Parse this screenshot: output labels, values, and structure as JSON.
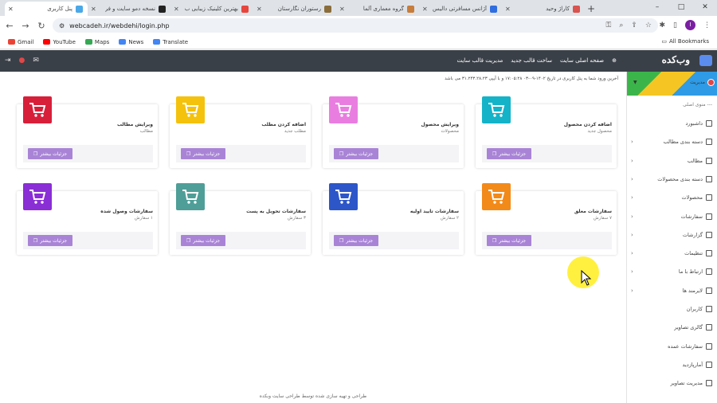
{
  "browser": {
    "tabs": [
      {
        "title": "پنل کاربری",
        "color": "#4aa8e8",
        "active": true
      },
      {
        "title": "نسخه دمو سایت و فر",
        "color": "#222222"
      },
      {
        "title": "بهترین کلینیک زیبایی ب",
        "color": "#e8453c"
      },
      {
        "title": "رستوران نگارستان",
        "color": "#8a6d3b"
      },
      {
        "title": "گروه معماری آلما",
        "color": "#c77d3b"
      },
      {
        "title": "آژانس مسافرتی دالیس",
        "color": "#2f6de1"
      },
      {
        "title": "کاراژ وحید",
        "color": "#d9534f"
      }
    ],
    "new_tab": "+",
    "window_controls": [
      "–",
      "□",
      "✕"
    ],
    "url": "webcadeh.ir/webdehi/login.php",
    "bookmarks": [
      {
        "label": "Gmail",
        "color": "#ea4335"
      },
      {
        "label": "YouTube",
        "color": "#ff0000"
      },
      {
        "label": "Maps",
        "color": "#34a853"
      },
      {
        "label": "News",
        "color": "#4285f4"
      },
      {
        "label": "Translate",
        "color": "#4285f4"
      }
    ],
    "all_bookmarks": "All Bookmarks",
    "profile_initial": "I"
  },
  "topnav": {
    "links": [
      "صفحه اصلی سایت",
      "ساخت قالب جدید",
      "مدیریت قالب سایت"
    ]
  },
  "brand": {
    "logo_text": "وب‌کده"
  },
  "user": {
    "name": "مدیریت"
  },
  "sidebar": {
    "menu_title": "--- منوی اصلی",
    "items": [
      {
        "label": "داشبورد",
        "caret": false
      },
      {
        "label": "دسته بندی مطالب",
        "caret": true
      },
      {
        "label": "مطالب",
        "caret": true
      },
      {
        "label": "دسته بندی محصولات",
        "caret": true
      },
      {
        "label": "محصولات",
        "caret": true
      },
      {
        "label": "سفارشات",
        "caret": true
      },
      {
        "label": "گزارشات",
        "caret": true
      },
      {
        "label": "تنظیمات",
        "caret": true
      },
      {
        "label": "ارتباط با ما",
        "caret": true
      },
      {
        "label": "لایرمند ها",
        "caret": true
      },
      {
        "label": "کاربران",
        "caret": false
      },
      {
        "label": "گالری تصاویر",
        "caret": false
      },
      {
        "label": "سفارشات عمده",
        "caret": false
      },
      {
        "label": "آمارپازدید",
        "caret": false
      },
      {
        "label": "مدیریت تصاویر",
        "caret": false
      }
    ]
  },
  "last_login": "آخرین ورود شما به پنل کاربری در تاریخ ۱۴۰۲-۰۹-۰۳ ۱۷:۰۵:۲۸ و با آیپی ۳۱.۲۴۳.۲۸.۲۳ می باشد",
  "cards": [
    {
      "title": "اضافه کردن محصول",
      "sub": "محصول جدید",
      "color": "#14b3c8",
      "icon": "cart-add-icon",
      "btn": "جزئیات بیشتر"
    },
    {
      "title": "ویرایش محصول",
      "sub": "محصولات",
      "color": "#e97ee0",
      "icon": "cart-edit-icon",
      "btn": "جزئیات بیشتر"
    },
    {
      "title": "اضافه کردن مطلب",
      "sub": "مطلب جدید",
      "color": "#f4c20d",
      "icon": "file-add-icon",
      "btn": "جزئیات بیشتر"
    },
    {
      "title": "ویرایش مطالب",
      "sub": "مطالب",
      "color": "#d81f3a",
      "icon": "file-remove-icon",
      "btn": "جزئیات بیشتر"
    },
    {
      "title": "سفارشات معلق",
      "sub": "۷ سفارش",
      "color": "#f28a1a",
      "icon": "cart-alert-icon",
      "btn": "جزئیات بیشتر"
    },
    {
      "title": "سفارشات تایید اولیه",
      "sub": "۲ سفارش",
      "color": "#2d56c8",
      "icon": "cart-down-icon",
      "btn": "جزئیات بیشتر"
    },
    {
      "title": "سفارشات تحویل به پست",
      "sub": "۳ سفارش",
      "color": "#4f9e98",
      "icon": "cart-list-icon",
      "btn": "جزئیات بیشتر"
    },
    {
      "title": "سفارشات وصول شده",
      "sub": "۱ سفارش",
      "color": "#8a2ed6",
      "icon": "cart-check-icon",
      "btn": "جزئیات بیشتر"
    }
  ],
  "footer": "طراحی و تهیه سازی شده توسط طراحی سایت وبکده"
}
